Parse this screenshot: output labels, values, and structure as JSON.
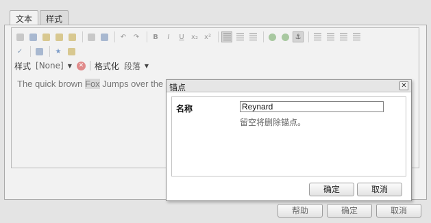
{
  "tabs": [
    {
      "label": "文本"
    },
    {
      "label": "样式"
    }
  ],
  "editor": {
    "style_label": "样式",
    "style_value": "[None]",
    "format_label": "格式化",
    "format_value": "段落",
    "content_before": "The quick brown ",
    "content_selected": "Fox",
    "content_after": " Jumps over the lazy dog."
  },
  "toolbar": {
    "row1_icons": [
      "cut-icon",
      "copy-icon",
      "paste-icon",
      "paste-text-icon",
      "paste-word-icon",
      "find-icon",
      "replace-icon",
      "undo-icon",
      "redo-icon",
      "bold-icon",
      "italic-icon",
      "underline-icon",
      "subscript-icon",
      "superscript-icon",
      "align-left-icon",
      "align-center-icon",
      "align-right-icon",
      "link-icon",
      "unlink-icon",
      "anchor-icon",
      "bulleted-list-icon",
      "numbered-list-icon",
      "outdent-icon",
      "indent-icon"
    ],
    "row2_icons": [
      "spellcheck-icon",
      "table-icon",
      "special-char-icon",
      "source-edit-icon"
    ]
  },
  "dialog": {
    "title": "锚点",
    "field_label": "名称",
    "field_value": "Reynard",
    "hint": "留空将删除锚点。",
    "ok": "确定",
    "cancel": "取消",
    "close_glyph": "✕"
  },
  "footer": {
    "help": "帮助",
    "ok": "确定",
    "cancel": "取消"
  }
}
